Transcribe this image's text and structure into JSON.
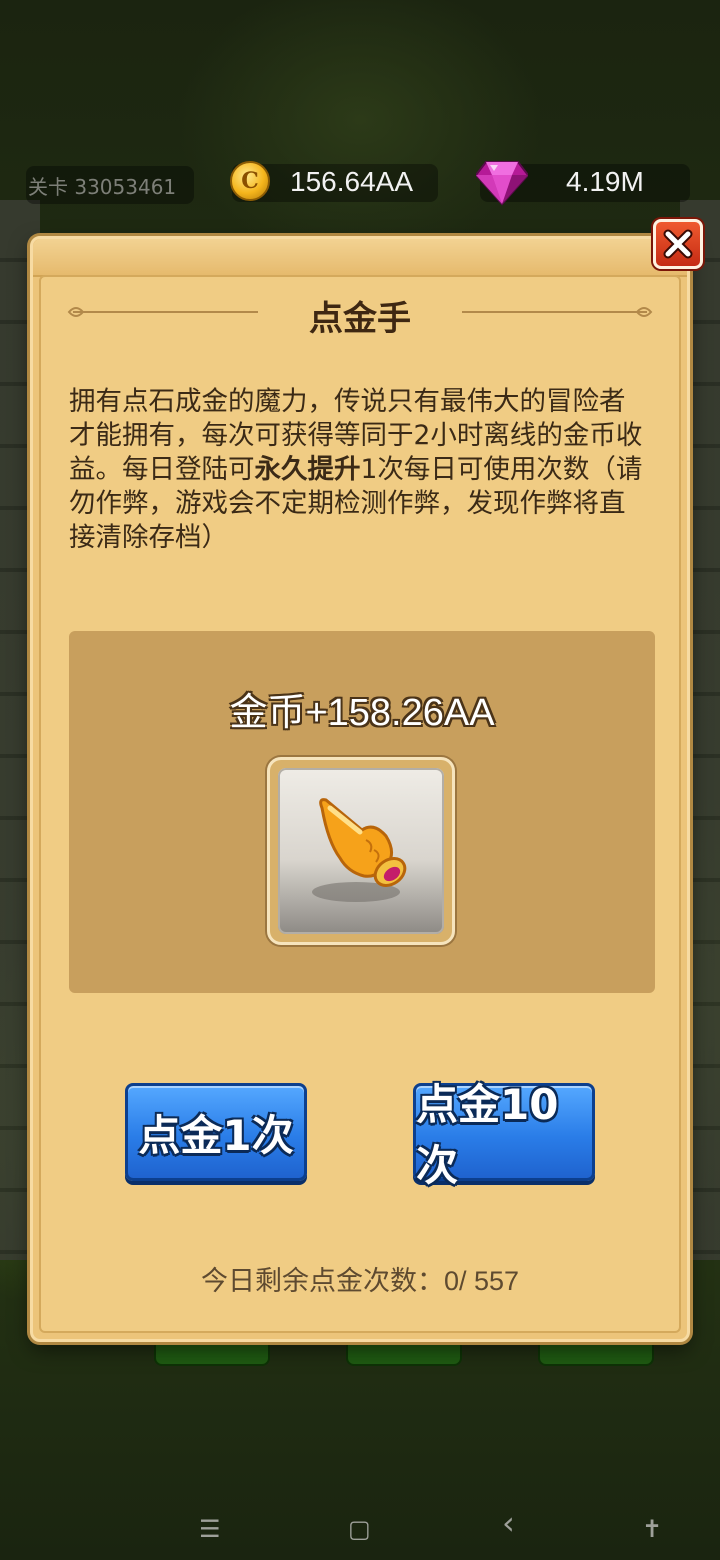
{
  "hud": {
    "level": "关卡 33053461",
    "coins": "156.64AA",
    "gems": "4.19M",
    "coin_symbol": "C",
    "coin_icon": "gold-coin-icon",
    "gem_icon": "pink-gem-icon"
  },
  "dialog": {
    "title": "点金手",
    "description_1": "拥有点石成金的魔力，传说只有最伟大的冒险者才能拥有，每次可获得等同于2小时离线的金币收益。每日登陆可",
    "description_bold": "永久提升",
    "description_2": "1次每日可使用次数（请勿作弊，游戏会不定期检测作弊，发现作弊将直接清除存档）",
    "reward": "金币+158.26AA",
    "item_icon": "midas-hand-icon",
    "button_once": "点金1次",
    "button_ten": "点金10次",
    "remaining_label": "今日剩余点金次数：",
    "remaining_value": "0/ 557",
    "close_icon": "close-icon"
  },
  "navbar": {
    "menu_icon": "☰",
    "home_icon": "▢",
    "back_icon": "‹",
    "accessibility_icon": "✝"
  },
  "colors": {
    "panel_bg": "#f0cc84",
    "reward_panel": "#c89f5d",
    "button_blue": "#2a7de8",
    "close_red": "#d6391c"
  }
}
